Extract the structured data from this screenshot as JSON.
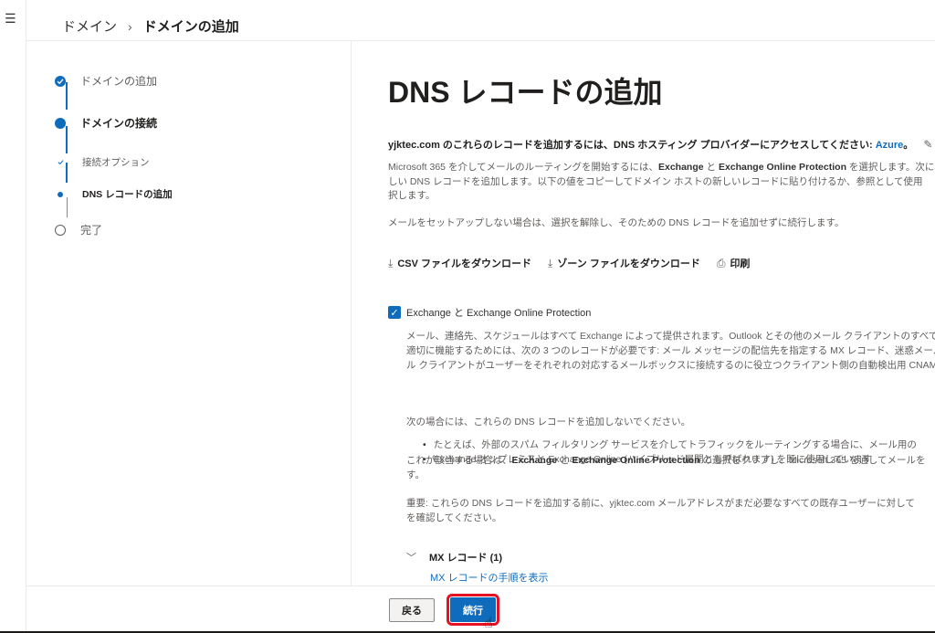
{
  "nav": {
    "menu_icon": "hamburger-icon"
  },
  "breadcrumb": {
    "parent": "ドメイン",
    "separator": "›",
    "current": "ドメインの追加"
  },
  "steps": [
    {
      "label": "ドメインの追加",
      "state": "done"
    },
    {
      "label": "ドメインの接続",
      "state": "current"
    },
    {
      "label": "接続オプション",
      "state": "done-sub"
    },
    {
      "label": "DNS レコードの追加",
      "state": "current-sub"
    },
    {
      "label": "完了",
      "state": "pending"
    }
  ],
  "main": {
    "title": "DNS レコードの追加",
    "intro": {
      "domain": "yjktec.com",
      "text": " のこれらのレコードを追加するには、DNS ホスティング プロバイダーにアクセスしてください: ",
      "provider": "Azure",
      "end": "。"
    },
    "para1": {
      "line1_a": "Microsoft 365 を介してメールのルーティングを開始するには、",
      "line1_b": "Exchange",
      "line1_c": " と ",
      "line1_d": "Exchange Online Protection",
      "line1_e": " を選択します。次に、新",
      "line2": "しい DNS レコードを追加します。以下の値をコピーしてドメイン ホストの新しいレコードに貼り付けるか、参照として使用",
      "line3": "択します。"
    },
    "para2": "メールをセットアップしない場合は、選択を解除し、そのための DNS レコードを追加せずに続行します。",
    "actions": {
      "csv": "CSV ファイルをダウンロード",
      "zone": "ゾーン ファイルをダウンロード",
      "print": "印刷"
    },
    "exchange_checkbox": {
      "label": "Exchange と Exchange Online Protection",
      "checked": true
    },
    "desc1": {
      "line1": "メール、連絡先、スケジュールはすべて Exchange によって提供されます。Outlook とその他のメール クライアントのすべての",
      "line2": "適切に機能するためには、次の 3 つのレコードが必要です: メール メッセージの配信先を指定する MX レコード、迷惑メールの",
      "line3": "ル クライアントがユーザーをそれぞれの対応するメールボックスに接続するのに役立つクライアント側の自動検出用 CNAME"
    },
    "desc2": "次の場合には、これらの DNS レコードを追加しないでください。",
    "bullets": [
      "たとえば、外部のスパム フィルタリング サービスを介してトラフィックをルーティングする場合に、メール用の",
      "Exchange オンプレミスと Exchange Online (ハイブリッド展開とも呼ばれます) を既に使用しています"
    ],
    "desc3": {
      "line1_a": "これが該当する場合は、",
      "line1_b": "Exchange",
      "line1_c": " と ",
      "line1_d": "Exchange Online Protection",
      "line1_e": " の選択をクリアし、Microsoft 365 を通してメールを",
      "line2": "す。"
    },
    "desc4": {
      "line1": "重要: これらの DNS レコードを追加する前に、yjktec.com メールアドレスがまだ必要なすべての既存ユーザーに対して",
      "line2": "を確認してください。"
    },
    "mx": {
      "title": "MX レコード (1)",
      "link": "MX レコードの手順を表示"
    }
  },
  "footer": {
    "back": "戻る",
    "next": "続行"
  }
}
